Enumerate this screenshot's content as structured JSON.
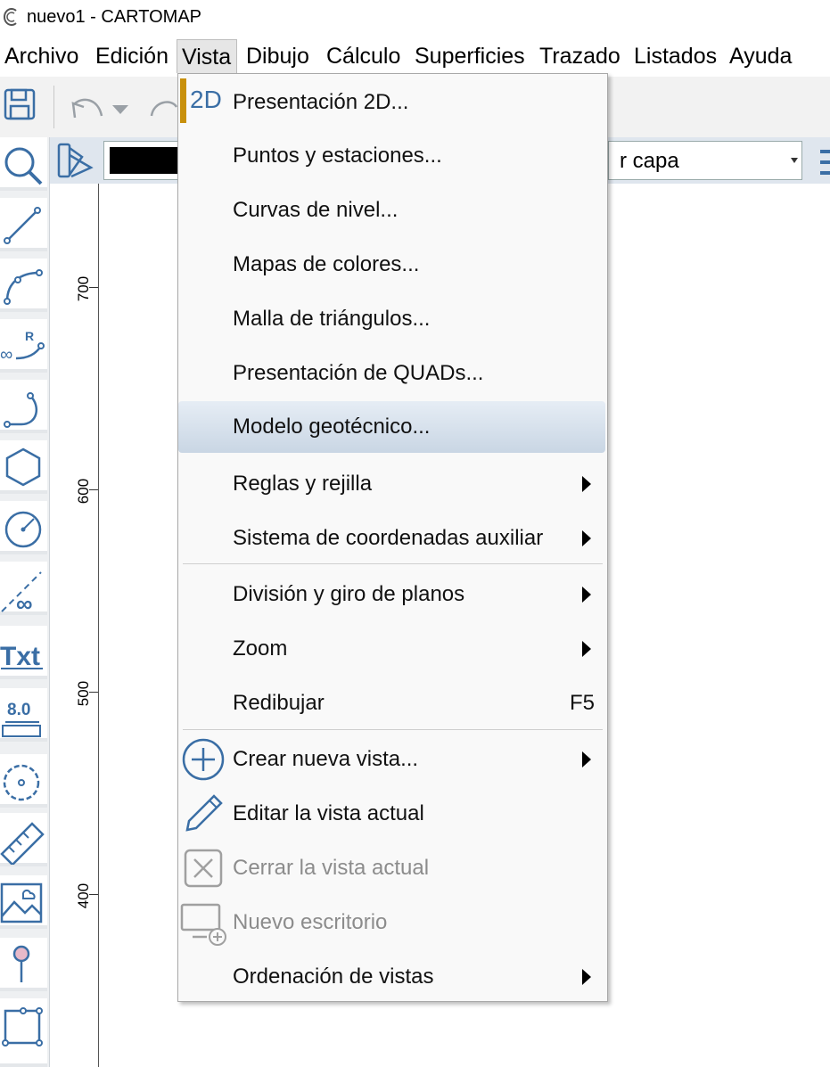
{
  "window": {
    "title": "nuevo1 - CARTOMAP"
  },
  "menubar": {
    "items": [
      {
        "label": "Archivo"
      },
      {
        "label": "Edición"
      },
      {
        "label": "Vista"
      },
      {
        "label": "Dibujo"
      },
      {
        "label": "Cálculo"
      },
      {
        "label": "Superficies"
      },
      {
        "label": "Trazado"
      },
      {
        "label": "Listados"
      },
      {
        "label": "Ayuda"
      }
    ],
    "active": "Vista"
  },
  "layerbar": {
    "layer_text": "r capa",
    "color": "#000000"
  },
  "ruler": {
    "labels": [
      "700",
      "600",
      "500",
      "400"
    ]
  },
  "vista_menu": {
    "items": [
      {
        "label": "Presentación 2D...",
        "icon": "2d-icon"
      },
      {
        "label": "Puntos y estaciones..."
      },
      {
        "label": "Curvas de nivel..."
      },
      {
        "label": "Mapas de colores..."
      },
      {
        "label": "Malla de triángulos..."
      },
      {
        "label": "Presentación de QUADs..."
      },
      {
        "label": "Modelo geotécnico...",
        "highlighted": true
      },
      {
        "label": "Reglas y rejilla",
        "submenu": true
      },
      {
        "label": "Sistema de coordenadas auxiliar",
        "submenu": true
      },
      {
        "label": "División y giro de planos",
        "submenu": true
      },
      {
        "label": "Zoom",
        "submenu": true
      },
      {
        "label": "Redibujar",
        "shortcut": "F5"
      },
      {
        "label": "Crear nueva vista...",
        "icon": "plus-circle-icon",
        "submenu": true
      },
      {
        "label": "Editar la vista actual",
        "icon": "pencil-icon"
      },
      {
        "label": "Cerrar la vista actual",
        "icon": "close-box-icon",
        "disabled": true
      },
      {
        "label": "Nuevo escritorio",
        "icon": "new-desktop-icon",
        "disabled": true
      },
      {
        "label": "Ordenación de vistas",
        "submenu": true
      }
    ]
  },
  "colors": {
    "accent": "#3a6ea5",
    "highlight": "#c9d6e4",
    "brand_bar": "#c8900c"
  }
}
